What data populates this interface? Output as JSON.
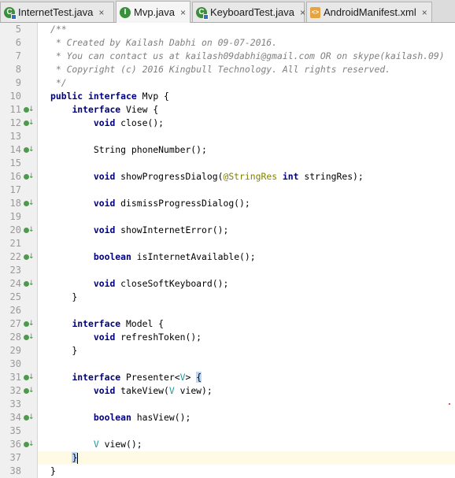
{
  "tabs": [
    {
      "label": "InternetTest.java",
      "icon": "java-class-icon",
      "active": false
    },
    {
      "label": "Mvp.java",
      "icon": "java-interface-icon",
      "active": true
    },
    {
      "label": "KeyboardTest.java",
      "icon": "java-class-icon",
      "active": false
    },
    {
      "label": "AndroidManifest.xml",
      "icon": "xml-file-icon",
      "active": false
    }
  ],
  "close_glyph": "×",
  "lines": [
    {
      "n": "5",
      "text": "/**"
    },
    {
      "n": "6",
      "text": " * Created by Kailash Dabhi on 09-07-2016."
    },
    {
      "n": "7",
      "text": " * You can contact us at kailash09dabhi@gmail.com OR on skype(kailash.09)"
    },
    {
      "n": "8",
      "text": " * Copyright (c) 2016 Kingbull Technology. All rights reserved."
    },
    {
      "n": "9",
      "text": " */"
    },
    {
      "n": "10",
      "text": "public interface Mvp {"
    },
    {
      "n": "11",
      "text": "    interface View {",
      "marker": true
    },
    {
      "n": "12",
      "text": "        void close();",
      "marker": true
    },
    {
      "n": "13",
      "text": ""
    },
    {
      "n": "14",
      "text": "        String phoneNumber();",
      "marker": true
    },
    {
      "n": "15",
      "text": ""
    },
    {
      "n": "16",
      "text": "        void showProgressDialog(@StringRes int stringRes);",
      "marker": true
    },
    {
      "n": "17",
      "text": ""
    },
    {
      "n": "18",
      "text": "        void dismissProgressDialog();",
      "marker": true
    },
    {
      "n": "19",
      "text": ""
    },
    {
      "n": "20",
      "text": "        void showInternetError();",
      "marker": true
    },
    {
      "n": "21",
      "text": ""
    },
    {
      "n": "22",
      "text": "        boolean isInternetAvailable();",
      "marker": true
    },
    {
      "n": "23",
      "text": ""
    },
    {
      "n": "24",
      "text": "        void closeSoftKeyboard();",
      "marker": true
    },
    {
      "n": "25",
      "text": "    }"
    },
    {
      "n": "26",
      "text": ""
    },
    {
      "n": "27",
      "text": "    interface Model {",
      "marker": true
    },
    {
      "n": "28",
      "text": "        void refreshToken();",
      "marker": true
    },
    {
      "n": "29",
      "text": "    }"
    },
    {
      "n": "30",
      "text": ""
    },
    {
      "n": "31",
      "text": "    interface Presenter<V> {",
      "marker": true
    },
    {
      "n": "32",
      "text": "        void takeView(V view);",
      "marker": true
    },
    {
      "n": "33",
      "text": ""
    },
    {
      "n": "34",
      "text": "        boolean hasView();",
      "marker": true
    },
    {
      "n": "35",
      "text": ""
    },
    {
      "n": "36",
      "text": "        V view();",
      "marker": true
    },
    {
      "n": "37",
      "text": "    }",
      "current": true
    },
    {
      "n": "38",
      "text": "}"
    }
  ],
  "colors": {
    "keyword": "#000080",
    "comment": "#808080",
    "annotation": "#808000",
    "type_param": "#20999d",
    "current_line": "#fffae3",
    "brace_match": "#b8d8ff"
  }
}
